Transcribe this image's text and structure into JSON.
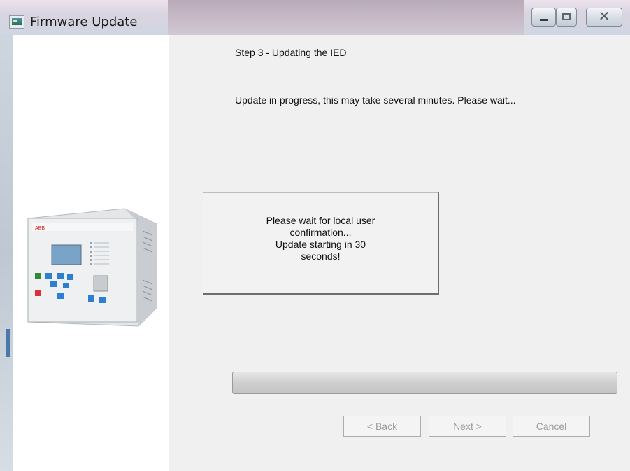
{
  "window": {
    "title": "Firmware Update",
    "icon": "app-icon",
    "controls": {
      "minimize_icon": "minimize-icon",
      "maximize_icon": "maximize-icon",
      "close_icon": "close-icon",
      "close_glyph": "✕"
    }
  },
  "wizard": {
    "step_title": "Step 3 - Updating the IED",
    "status_text": "Update in progress, this may take several minutes. Please wait...",
    "message": "Please wait for local user\nconfirmation...\nUpdate starting in 30\nseconds!",
    "progress": 0,
    "buttons": {
      "back": "< Back",
      "next": "Next >",
      "cancel": "Cancel"
    }
  },
  "device_image": {
    "brand": "ABB"
  },
  "colors": {
    "panel_bg": "#f0f0f0",
    "disabled_text": "#9d9d9d"
  }
}
